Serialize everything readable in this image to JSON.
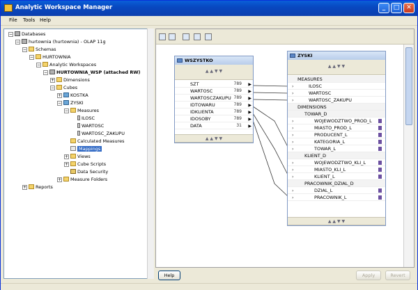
{
  "window": {
    "title": "Analytic Workspace Manager",
    "min": "_",
    "max": "□",
    "close": "✕"
  },
  "menu": [
    "File",
    "Tools",
    "Help"
  ],
  "tree": [
    {
      "label": "Databases"
    },
    {
      "label": "hurtownia (hurtownia) - OLAP 11g"
    },
    {
      "label": "Schemas"
    },
    {
      "label": "HURTOWNIA"
    },
    {
      "label": "Analytic Workspaces"
    },
    {
      "label": "HURTOWNIA_WSP (attached RW)"
    },
    {
      "label": "Dimensions"
    },
    {
      "label": "Cubes"
    },
    {
      "label": "KOSTKA"
    },
    {
      "label": "ZYSKI"
    },
    {
      "label": "Measures"
    },
    {
      "label": "ILOSC"
    },
    {
      "label": "WARTOSC"
    },
    {
      "label": "WARTOSC_ZAKUPU"
    },
    {
      "label": "Calculated Measures"
    },
    {
      "label": "Mappings"
    },
    {
      "label": "Views"
    },
    {
      "label": "Cube Scripts"
    },
    {
      "label": "Data Security"
    },
    {
      "label": "Measure Folders"
    },
    {
      "label": "Reports"
    }
  ],
  "source_table": {
    "name": "WSZYSTKO",
    "columns": [
      {
        "name": "SZT",
        "type": "789"
      },
      {
        "name": "WARTOSC",
        "type": "789"
      },
      {
        "name": "WARTOSCZAKUPU",
        "type": "789"
      },
      {
        "name": "IDTOWARU",
        "type": "789"
      },
      {
        "name": "IDKLIENTA",
        "type": "789"
      },
      {
        "name": "IDOSOBY",
        "type": "789"
      },
      {
        "name": "DATA",
        "type": "31"
      }
    ]
  },
  "target_cube": {
    "name": "ZYSKI",
    "measures_label": "MEASURES",
    "measures": [
      "ILOSC",
      "WARTOSC",
      "WARTOSC_ZAKUPU"
    ],
    "dimensions_label": "DIMENSIONS",
    "dimensions": [
      {
        "name": "TOWAR_D",
        "levels": [
          "WOJEWODZTWO_PROD_L",
          "MIASTO_PROD_L",
          "PRODUCENT_L",
          "KATEGORIA_L",
          "TOWAR_L"
        ]
      },
      {
        "name": "KLIENT_D",
        "levels": [
          "WOJEWODZTWO_KLI_L",
          "MIASTO_KLI_L",
          "KLIENT_L"
        ]
      },
      {
        "name": "PRACOWNIK_DZIAL_D",
        "levels": [
          "DZIAL_L",
          "PRACOWNIK_L"
        ]
      }
    ]
  },
  "buttons": {
    "help": "Help",
    "apply": "Apply",
    "revert": "Revert"
  }
}
